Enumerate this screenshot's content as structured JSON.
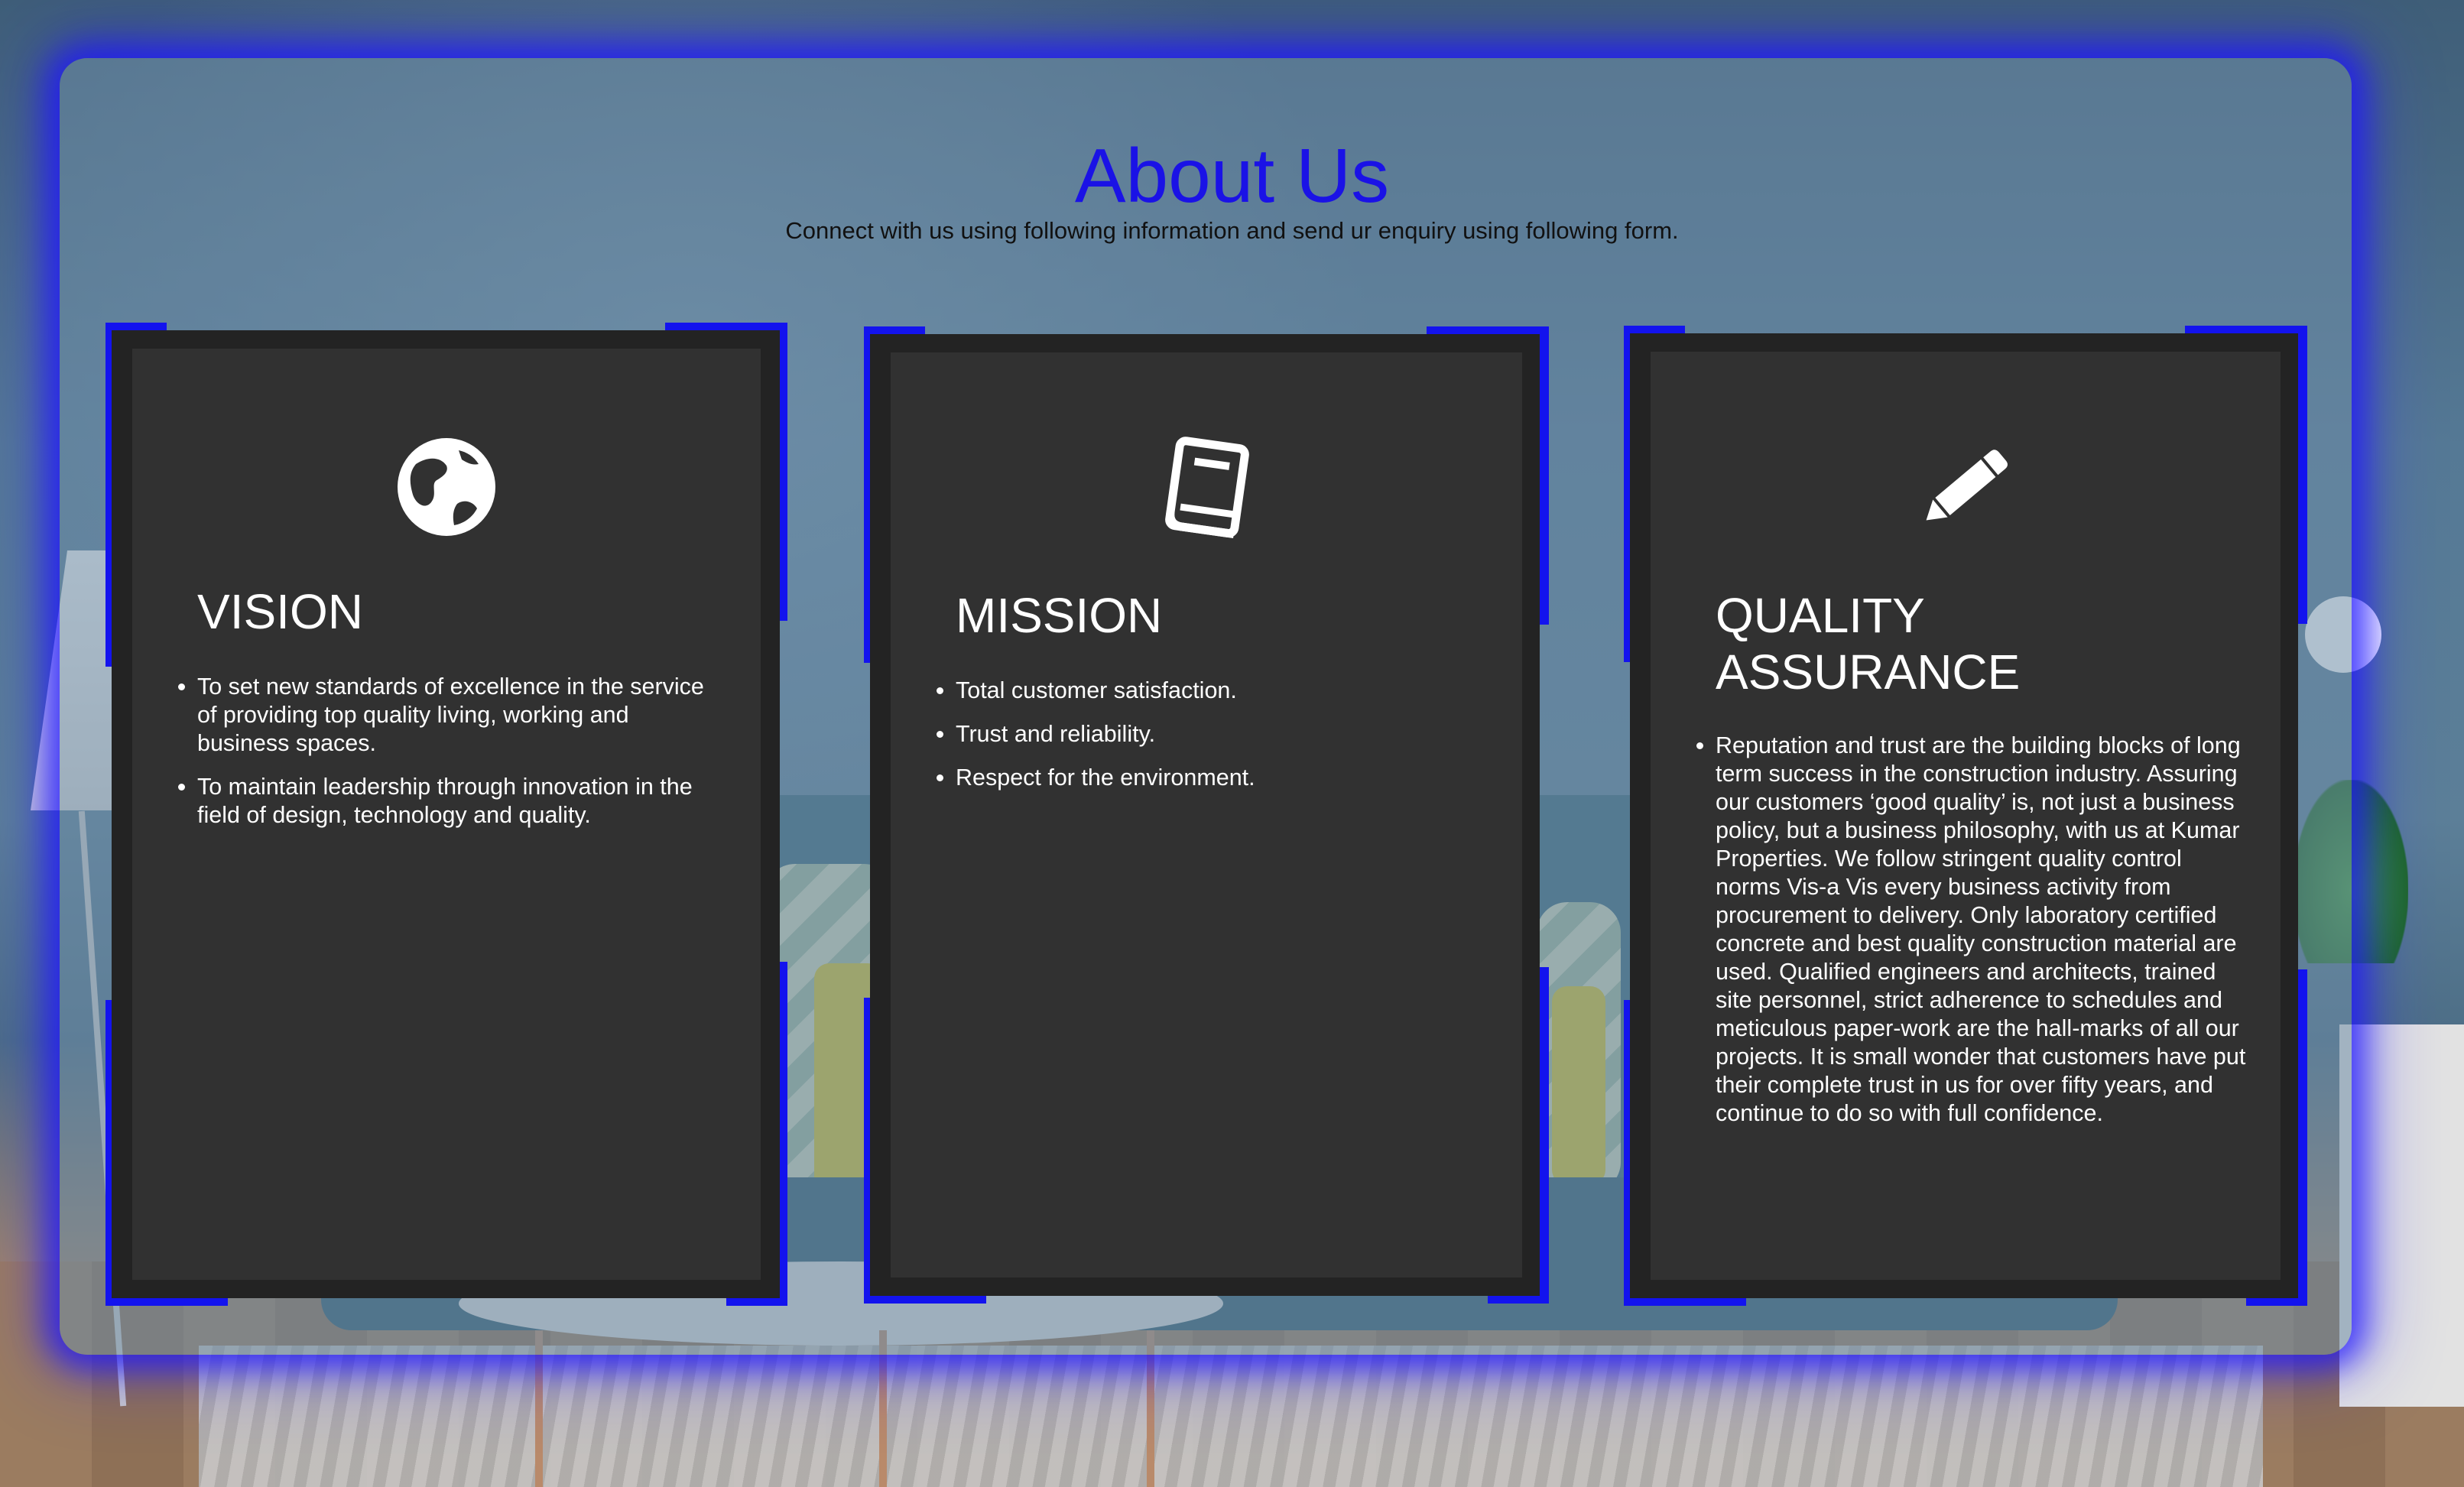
{
  "header": {
    "title": "About Us",
    "subtitle": "Connect with us using following information and send ur enquiry using following form."
  },
  "cards": [
    {
      "icon": "globe-icon",
      "title": "VISION",
      "items": [
        "To set new standards of excellence in the service of providing top quality living, working and business spaces.",
        "To maintain leadership through innovation in the field of design, technology and quality."
      ]
    },
    {
      "icon": "book-icon",
      "title": "MISSION",
      "items": [
        "Total customer satisfaction.",
        "Trust and reliability.",
        "Respect for the environment."
      ]
    },
    {
      "icon": "pencil-icon",
      "title_lines": [
        "QUALITY",
        "ASSURANCE"
      ],
      "items": [
        "Reputation and trust are the building blocks of long term success in the construction industry. Assuring our customers ‘good quality’ is, not just a business policy, but a business philosophy, with us at Kumar Properties. We follow stringent quality control norms Vis-a Vis every business activity from procurement to delivery. Only laboratory certified concrete and best quality construction material are used. Qualified engineers and architects, trained site personnel, strict adherence to schedules and meticulous paper-work are the hall-marks of all our projects. It is small wonder that customers have put their complete trust in us for over fifty years, and continue to do so with full confidence."
      ]
    }
  ],
  "colors": {
    "accent": "#1a12e6",
    "card_frame": "#232323",
    "card_inner": "#313131",
    "card_text": "#ffffff",
    "glow": "#1313ee"
  }
}
